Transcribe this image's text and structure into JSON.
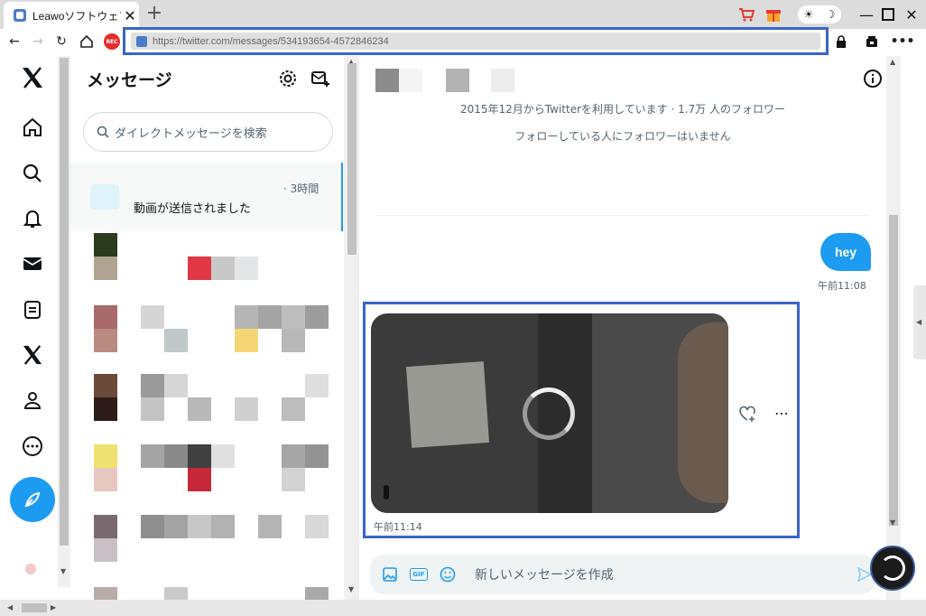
{
  "browser": {
    "tab_title": "Leawoソフトウェア / ",
    "url": "https://twitter.com/messages/534193654-4572846234",
    "rec_label": "REC"
  },
  "dm": {
    "title": "メッセージ",
    "search_placeholder": "ダイレクトメッセージを検索",
    "active_conversation": {
      "time": "· 3時間",
      "preview": "動画が送信されました"
    }
  },
  "chat": {
    "joined_text": "2015年12月からTwitterを利用しています · 1.7万 人のフォロワー",
    "follow_text": "フォローしている人にフォロワーはいません",
    "outgoing_message": "hey",
    "outgoing_time": "午前11:08",
    "incoming_media_time": "午前11:14",
    "composer_placeholder": "新しいメッセージを作成",
    "gif_label": "GIF"
  },
  "colors": {
    "accent": "#1d9bf0",
    "highlight_border": "#3b64c8"
  }
}
